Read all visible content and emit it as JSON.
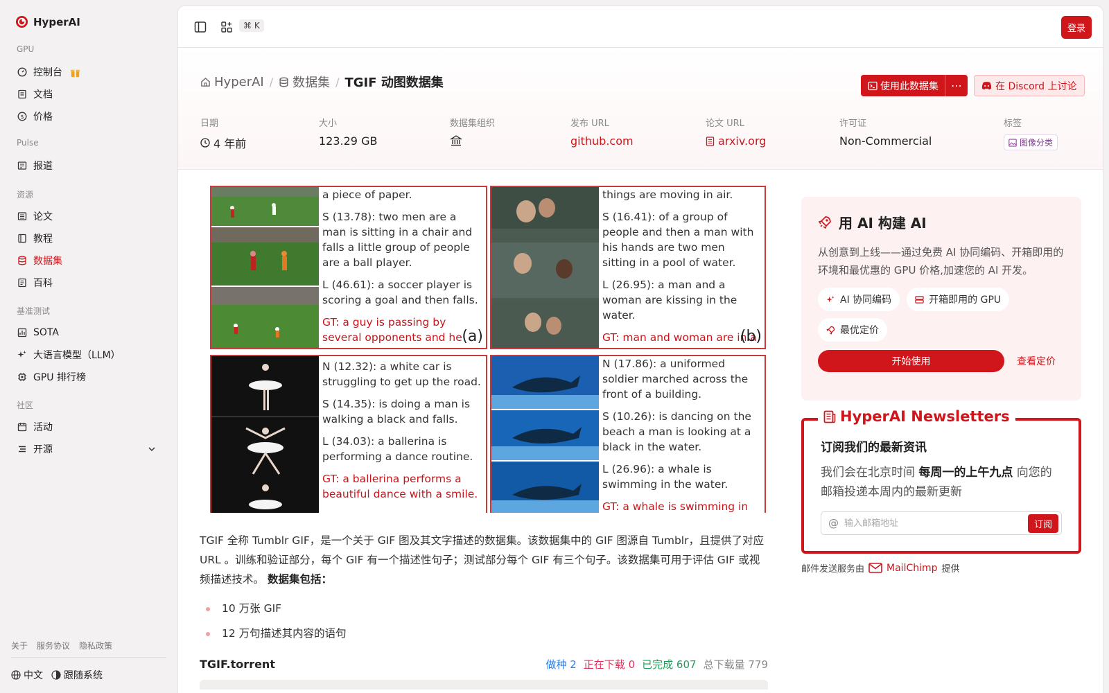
{
  "brand": {
    "name": "HyperAI"
  },
  "sidebar": {
    "sections": [
      {
        "title": "GPU",
        "items": [
          {
            "label": "控制台",
            "icon": "dashboard-icon",
            "gift": true
          },
          {
            "label": "文档",
            "icon": "doc-icon"
          },
          {
            "label": "价格",
            "icon": "price-icon"
          }
        ]
      },
      {
        "title": "Pulse",
        "items": [
          {
            "label": "报道",
            "icon": "news-icon"
          }
        ]
      },
      {
        "title": "资源",
        "items": [
          {
            "label": "论文",
            "icon": "paper-icon"
          },
          {
            "label": "教程",
            "icon": "tutorial-icon"
          },
          {
            "label": "数据集",
            "icon": "database-icon",
            "active": true
          },
          {
            "label": "百科",
            "icon": "wiki-icon"
          }
        ]
      },
      {
        "title": "基准测试",
        "items": [
          {
            "label": "SOTA",
            "icon": "chart-icon"
          },
          {
            "label": "大语言模型（LLM）",
            "icon": "sparkle-icon"
          },
          {
            "label": "GPU 排行榜",
            "icon": "chip-icon"
          }
        ]
      },
      {
        "title": "社区",
        "items": [
          {
            "label": "活动",
            "icon": "calendar-icon"
          },
          {
            "label": "开源",
            "icon": "list-icon",
            "expandable": true
          }
        ]
      }
    ],
    "footer_links": [
      "关于",
      "服务协议",
      "隐私政策"
    ],
    "language": "中文",
    "theme": "跟随系统"
  },
  "topbar": {
    "shortcut": "⌘ K",
    "login": "登录"
  },
  "breadcrumb": {
    "home": "HyperAI",
    "section": "数据集",
    "current": "TGIF 动图数据集"
  },
  "actions": {
    "use_dataset": "使用此数据集",
    "more": "⋯",
    "discord": "在 Discord 上讨论"
  },
  "meta": [
    {
      "label": "日期",
      "value": "4 年前",
      "icon": "clock-icon"
    },
    {
      "label": "大小",
      "value": "123.29 GB"
    },
    {
      "label": "数据集组织",
      "value": "",
      "icon": "institution-icon"
    },
    {
      "label": "发布 URL",
      "value": "github.com",
      "link": true
    },
    {
      "label": "论文 URL",
      "value": "arxiv.org",
      "link": true,
      "icon": "file-icon"
    },
    {
      "label": "许可证",
      "value": "Non-Commercial"
    },
    {
      "label": "标签",
      "value": "图像分类",
      "chip": true
    }
  ],
  "figure": {
    "panels": [
      {
        "label": "(a)",
        "lines": [
          {
            "text": "a piece of paper.",
            "gt": false
          },
          {
            "text": "S (13.78): two men are a man is sitting in a chair and falls a little group of people are a ball player.",
            "gt": false
          },
          {
            "text": "L (46.61): a soccer player is scoring a goal and then falls.",
            "gt": false
          },
          {
            "text": "GT: a guy is passing by several opponents and he scores.",
            "gt": true
          }
        ]
      },
      {
        "label": "(b)",
        "lines": [
          {
            "text": "things are moving in air.",
            "gt": false
          },
          {
            "text": "S (16.41): of a group of people and then a man with his hands are two men sitting in a pool of water.",
            "gt": false
          },
          {
            "text": "L (26.95): a man and a woman are kissing in the water.",
            "gt": false
          },
          {
            "text": "GT: man and woman are in a lake and hugging each other.",
            "gt": true
          }
        ]
      },
      {
        "label": "",
        "lines": [
          {
            "text": "N (12.32): a white car is struggling to get up the road.",
            "gt": false
          },
          {
            "text": "S (14.35): is doing a man is walking a black and falls.",
            "gt": false
          },
          {
            "text": "L (34.03): a ballerina is performing a dance routine.",
            "gt": false
          },
          {
            "text": "GT: a ballerina performs a beautiful dance with a smile.",
            "gt": true
          }
        ]
      },
      {
        "label": "",
        "lines": [
          {
            "text": "N (17.86): a uniformed soldier marched across the front of a building.",
            "gt": false
          },
          {
            "text": "S (10.26): is dancing on the beach a man is looking at a black in the water.",
            "gt": false
          },
          {
            "text": "L (26.96): a whale is swimming in the water.",
            "gt": false
          },
          {
            "text": "GT: a whale is swimming in the water.",
            "gt": true
          }
        ]
      }
    ]
  },
  "description": {
    "text": "TGIF 全称 Tumblr GIF，是一个关于 GIF 图及其文字描述的数据集。该数据集中的 GIF 图源自 Tumblr，且提供了对应 URL 。训练和验证部分，每个 GIF 有一个描述性句子；测试部分每个 GIF 有三个句子。该数据集可用于评估 GIF 或视频描述技术。",
    "bold": "数据集包括：",
    "bullets": [
      "10 万张 GIF",
      "12 万句描述其内容的语句"
    ]
  },
  "torrent": {
    "name": "TGIF.torrent",
    "seed_label": "做种",
    "seed": "2",
    "downloading_label": "正在下载",
    "downloading": "0",
    "done_label": "已完成",
    "done": "607",
    "total_label": "总下载量",
    "total": "779"
  },
  "ai_card": {
    "title": "用 AI 构建 AI",
    "desc": "从创意到上线——通过免费 AI 协同编码、开箱即用的环境和最优惠的 GPU 价格,加速您的 AI 开发。",
    "chips": [
      "AI 协同编码",
      "开箱即用的 GPU",
      "最优定价"
    ],
    "start": "开始使用",
    "pricing": "查看定价"
  },
  "newsletter": {
    "legend": "HyperAI Newsletters",
    "subtitle": "订阅我们的最新资讯",
    "text_pre": "我们会在北京时间 ",
    "text_bold": "每周一的上午九点",
    "text_post": " 向您的邮箱投递本周内的最新更新",
    "placeholder": "输入邮箱地址",
    "subscribe": "订阅"
  },
  "mailchimp": {
    "pre": "邮件发送服务由",
    "brand": "MailChimp",
    "post": "提供"
  },
  "colors": {
    "accent": "#d0151b"
  }
}
